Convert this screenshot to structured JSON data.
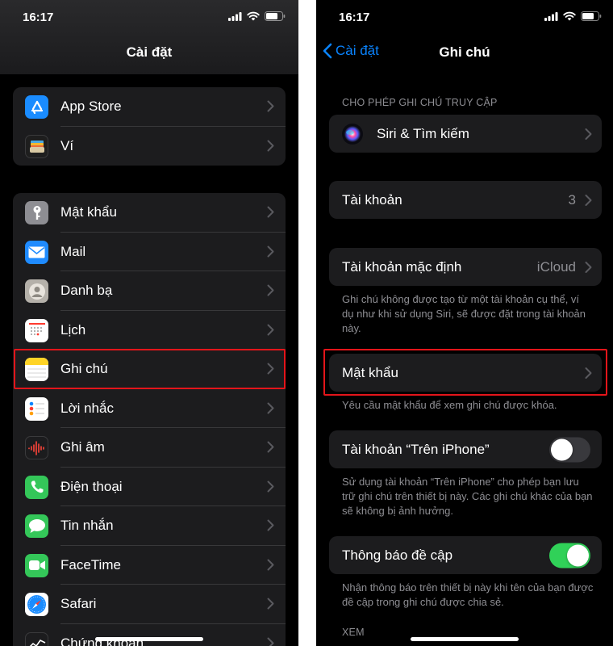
{
  "left_screen": {
    "status_time": "16:17",
    "nav_title": "Cài đặt",
    "group1": [
      {
        "label": "App Store",
        "icon": "app-store-icon",
        "color": "#1a8cff"
      },
      {
        "label": "Ví",
        "icon": "wallet-icon",
        "color": "#1e1e1e"
      }
    ],
    "group2": [
      {
        "label": "Mật khẩu",
        "icon": "key-icon",
        "color": "#8e8e93"
      },
      {
        "label": "Mail",
        "icon": "mail-icon",
        "color": "#1f8bff"
      },
      {
        "label": "Danh bạ",
        "icon": "contacts-icon",
        "color": "#b5b1aa"
      },
      {
        "label": "Lịch",
        "icon": "calendar-icon",
        "color": "#ffffff"
      },
      {
        "label": "Ghi chú",
        "icon": "notes-icon",
        "color": "#ffd426"
      },
      {
        "label": "Lời nhắc",
        "icon": "reminders-icon",
        "color": "#ffffff"
      },
      {
        "label": "Ghi âm",
        "icon": "voice-memos-icon",
        "color": "#1c1c1e"
      },
      {
        "label": "Điện thoại",
        "icon": "phone-icon",
        "color": "#34c759"
      },
      {
        "label": "Tin nhắn",
        "icon": "messages-icon",
        "color": "#34c759"
      },
      {
        "label": "FaceTime",
        "icon": "facetime-icon",
        "color": "#34c759"
      },
      {
        "label": "Safari",
        "icon": "safari-icon",
        "color": "#1a8cff"
      },
      {
        "label": "Chứng khoán",
        "icon": "stocks-icon",
        "color": "#1c1c1e"
      }
    ]
  },
  "right_screen": {
    "status_time": "16:17",
    "back_label": "Cài đặt",
    "nav_title": "Ghi chú",
    "section_allow": "CHO PHÉP GHI CHÚ TRUY CẬP",
    "siri_label": "Siri & Tìm kiếm",
    "accounts_label": "Tài khoản",
    "accounts_value": "3",
    "default_account_label": "Tài khoản mặc định",
    "default_account_value": "iCloud",
    "default_account_note": "Ghi chú không được tạo từ một tài khoản cụ thể, ví dụ như khi sử dụng Siri, sẽ được đặt trong tài khoản này.",
    "password_label": "Mật khẩu",
    "password_note": "Yêu cầu mật khẩu để xem ghi chú được khóa.",
    "on_iphone_label": "Tài khoản “Trên iPhone”",
    "on_iphone_enabled": false,
    "on_iphone_note": "Sử dụng tài khoản “Trên iPhone” cho phép bạn lưu trữ ghi chú trên thiết bị này. Các ghi chú khác của bạn sẽ không bị ảnh hưởng.",
    "mention_label": "Thông báo đề cập",
    "mention_enabled": true,
    "mention_note": "Nhận thông báo trên thiết bị này khi tên của bạn được đề cập trong ghi chú được chia sẻ.",
    "section_view": "XEM"
  },
  "colors": {
    "accent": "#0a84ff",
    "highlight": "#e3151a",
    "toggle_on": "#30d158"
  }
}
